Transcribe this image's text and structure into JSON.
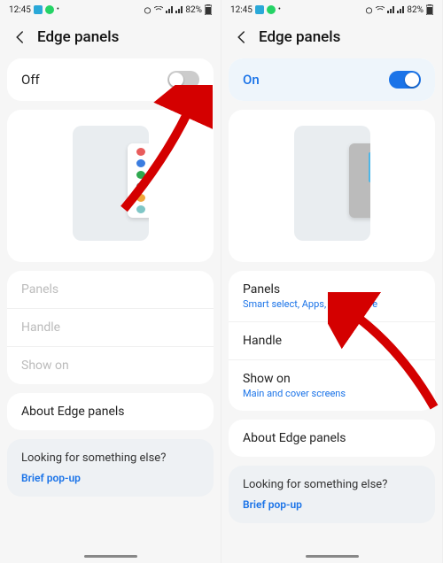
{
  "status": {
    "time": "12:45",
    "battery": "82%"
  },
  "header": {
    "title": "Edge panels"
  },
  "left": {
    "master": {
      "label": "Off",
      "on": false
    },
    "items": {
      "panels": {
        "label": "Panels"
      },
      "handle": {
        "label": "Handle"
      },
      "showon": {
        "label": "Show on"
      }
    },
    "about": {
      "label": "About Edge panels"
    }
  },
  "right": {
    "master": {
      "label": "On",
      "on": true
    },
    "items": {
      "panels": {
        "label": "Panels",
        "sub": "Smart select, Apps, and 3 more"
      },
      "handle": {
        "label": "Handle"
      },
      "showon": {
        "label": "Show on",
        "sub": "Main and cover screens"
      }
    },
    "about": {
      "label": "About Edge panels"
    }
  },
  "footer": {
    "question": "Looking for something else?",
    "link": "Brief pop-up"
  },
  "dots": [
    "#e85c5c",
    "#3b7de0",
    "#2fa84f",
    "#6b6b6b",
    "#f0a63c",
    "#7fc6c6"
  ]
}
